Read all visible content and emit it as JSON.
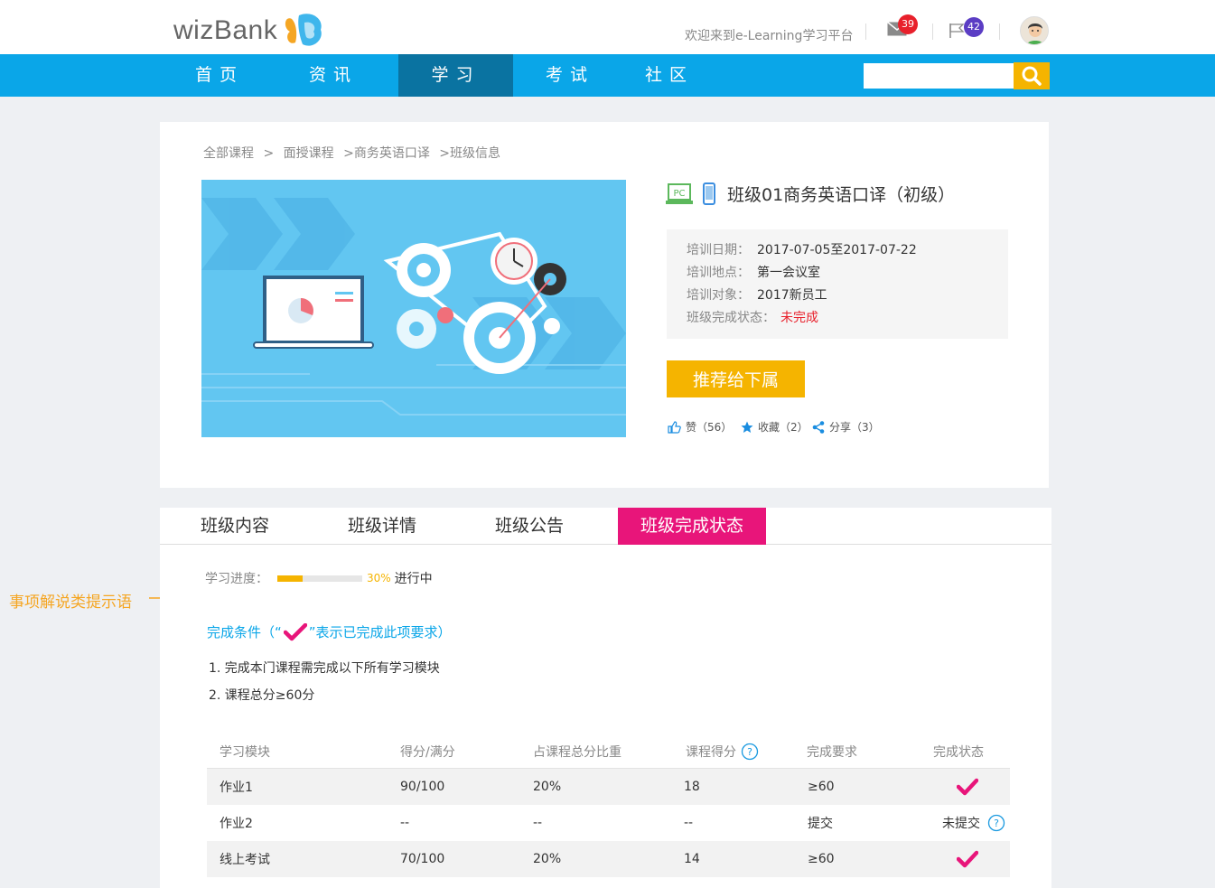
{
  "header": {
    "logo_text": "wizBank",
    "welcome": "欢迎来到e-Learning学习平台",
    "mail_count": "39",
    "flag_count": "42"
  },
  "nav": {
    "items": [
      "首页",
      "资讯",
      "学习",
      "考试",
      "社区"
    ],
    "active_index": 2,
    "search_placeholder": ""
  },
  "breadcrumb": [
    "全部课程",
    ">",
    "面授课程",
    ">商务英语口译",
    ">班级信息"
  ],
  "course": {
    "title": "班级01商务英语口译（初级）",
    "pc_label": "PC",
    "info": [
      {
        "label": "培训日期：",
        "value": "2017-07-05至2017-07-22"
      },
      {
        "label": "培训地点：",
        "value": "第一会议室"
      },
      {
        "label": "培训对象：",
        "value": "2017新员工"
      }
    ],
    "status_label": "班级完成状态：",
    "status_value": "未完成",
    "recommend_label": "推荐给下属",
    "like_label": "赞（56）",
    "favorite_label": "收藏（2）",
    "share_label": "分享（3）"
  },
  "tabs": {
    "items": [
      "班级内容",
      "班级详情",
      "班级公告",
      "班级完成状态"
    ],
    "active_index": 3
  },
  "progress": {
    "label": "学习进度：",
    "percent_text": "30%",
    "percent_value": 30,
    "status": "进行中"
  },
  "annotation": "事项解说类提示语",
  "conditions": {
    "title_prefix": "完成条件（“",
    "title_suffix": "”表示已完成此项要求）",
    "items": [
      "1. 完成本门课程需完成以下所有学习模块",
      "2. 课程总分≥60分"
    ]
  },
  "table": {
    "headers": [
      "学习模块",
      "得分/满分",
      "占课程总分比重",
      "课程得分",
      "完成要求",
      "完成状态"
    ],
    "rows": [
      {
        "module": "作业1",
        "score": "90/100",
        "weight": "20%",
        "course_score": "18",
        "requirement": "≥60",
        "status": "",
        "done": true
      },
      {
        "module": "作业2",
        "score": "--",
        "weight": "--",
        "course_score": "--",
        "requirement": "提交",
        "status": "未提交",
        "done": false
      },
      {
        "module": "线上考试",
        "score": "70/100",
        "weight": "20%",
        "course_score": "14",
        "requirement": "≥60",
        "status": "",
        "done": true
      }
    ]
  },
  "colors": {
    "nav_blue": "#0aa6e8",
    "nav_active": "#0a73a1",
    "accent_yellow": "#f5b400",
    "accent_pink": "#e8157a",
    "status_red": "#e8202b"
  }
}
